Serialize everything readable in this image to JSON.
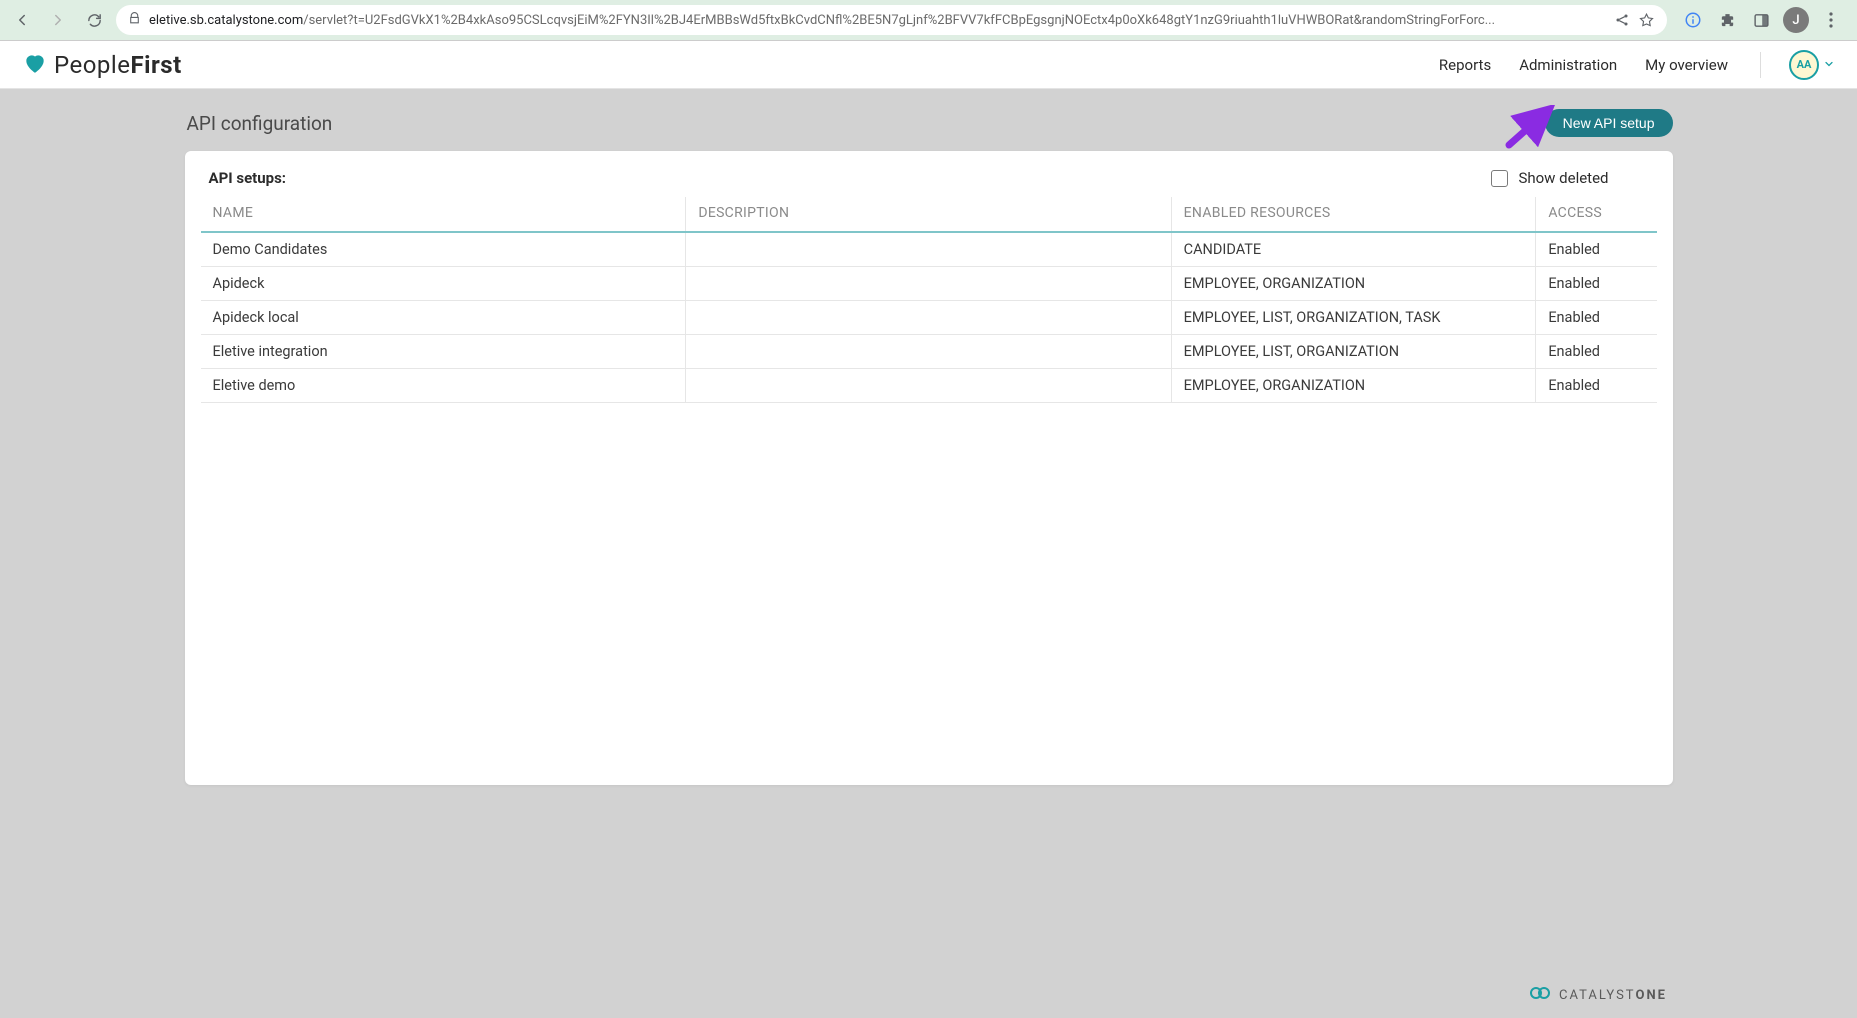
{
  "browser": {
    "url_domain": "eletive.sb.catalystone.com",
    "url_path": "/servlet?t=U2FsdGVkX1%2B4xkAso95CSLcqvsjEiM%2FYN3Il%2BJ4ErMBBsWd5ftxBkCvdCNfl%2BE5N7gLjnf%2BFVV7kfFCBpEgsgnjNOEctx4p0oXk648gtY1nzG9riuahth1luVHWBORat&randomStringForForc...",
    "profile_initial": "J"
  },
  "app": {
    "brand_prefix": "People",
    "brand_suffix": "First",
    "nav": {
      "reports": "Reports",
      "administration": "Administration",
      "my_overview": "My overview"
    },
    "user_initials": "AA"
  },
  "page": {
    "title": "API configuration",
    "new_btn": "New API setup"
  },
  "setups": {
    "label": "API setups:",
    "show_deleted": "Show deleted",
    "columns": {
      "name": "NAME",
      "description": "DESCRIPTION",
      "enabled_resources": "ENABLED RESOURCES",
      "access": "ACCESS"
    },
    "rows": [
      {
        "name": "Demo Candidates",
        "description": "",
        "resources": "CANDIDATE",
        "access": "Enabled"
      },
      {
        "name": "Apideck",
        "description": "",
        "resources": "EMPLOYEE, ORGANIZATION",
        "access": "Enabled"
      },
      {
        "name": "Apideck local",
        "description": "",
        "resources": "EMPLOYEE, LIST, ORGANIZATION, TASK",
        "access": "Enabled"
      },
      {
        "name": "Eletive integration",
        "description": "",
        "resources": "EMPLOYEE, LIST, ORGANIZATION",
        "access": "Enabled"
      },
      {
        "name": "Eletive demo",
        "description": "",
        "resources": "EMPLOYEE, ORGANIZATION",
        "access": "Enabled"
      }
    ]
  },
  "footer": {
    "brand_prefix": "CATALYST",
    "brand_suffix": "ONE"
  }
}
